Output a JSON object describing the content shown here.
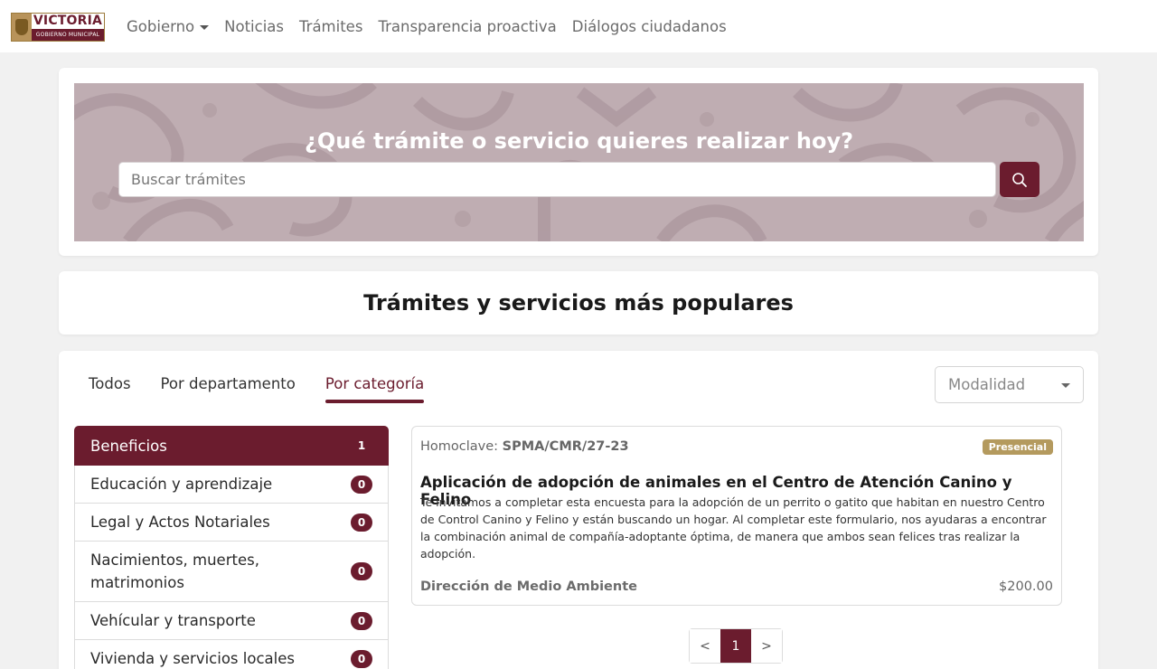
{
  "logo": {
    "main": "VICTORIA",
    "sub": "GOBIERNO MUNICIPAL"
  },
  "nav": {
    "items": [
      "Gobierno",
      "Noticias",
      "Trámites",
      "Transparencia proactiva",
      "Diálogos ciudadanos"
    ]
  },
  "hero": {
    "title": "¿Qué trámite o servicio quieres realizar hoy?",
    "search_placeholder": "Buscar trámites"
  },
  "section": {
    "title": "Trámites y servicios más populares"
  },
  "tabs": [
    "Todos",
    "Por departamento",
    "Por categoría"
  ],
  "modalidad": {
    "placeholder": "Modalidad"
  },
  "categories": [
    {
      "label": "Beneficios",
      "count": "1"
    },
    {
      "label": "Educación y aprendizaje",
      "count": "0"
    },
    {
      "label": "Legal y Actos Notariales",
      "count": "0"
    },
    {
      "label": "Nacimientos, muertes, matrimonios",
      "count": "0"
    },
    {
      "label": "Vehícular y transporte",
      "count": "0"
    },
    {
      "label": "Vivienda y servicios locales",
      "count": "0"
    }
  ],
  "result": {
    "homoclave_label": "Homoclave:",
    "homoclave": "SPMA/CMR/27-23",
    "tag": "Presencial",
    "title": "Aplicación de adopción de animales en el Centro de Atención Canino y Felino",
    "description": "Te invitamos a completar esta encuesta para la adopción de un perrito o gatito que habitan en nuestro Centro de Control Canino y Felino y están buscando un hogar. Al completar este formulario, nos ayudaras a encontrar la combinación animal de compañía-adoptante óptima, de manera que ambos sean felices tras realizar la adopción.",
    "department": "Dirección de Medio Ambiente",
    "price": "$200.00"
  },
  "pagination": {
    "prev": "<",
    "current": "1",
    "next": ">"
  },
  "colors": {
    "brand": "#6b1c2e",
    "gold": "#b49a5e",
    "hero_bg": "#bfadb2"
  }
}
